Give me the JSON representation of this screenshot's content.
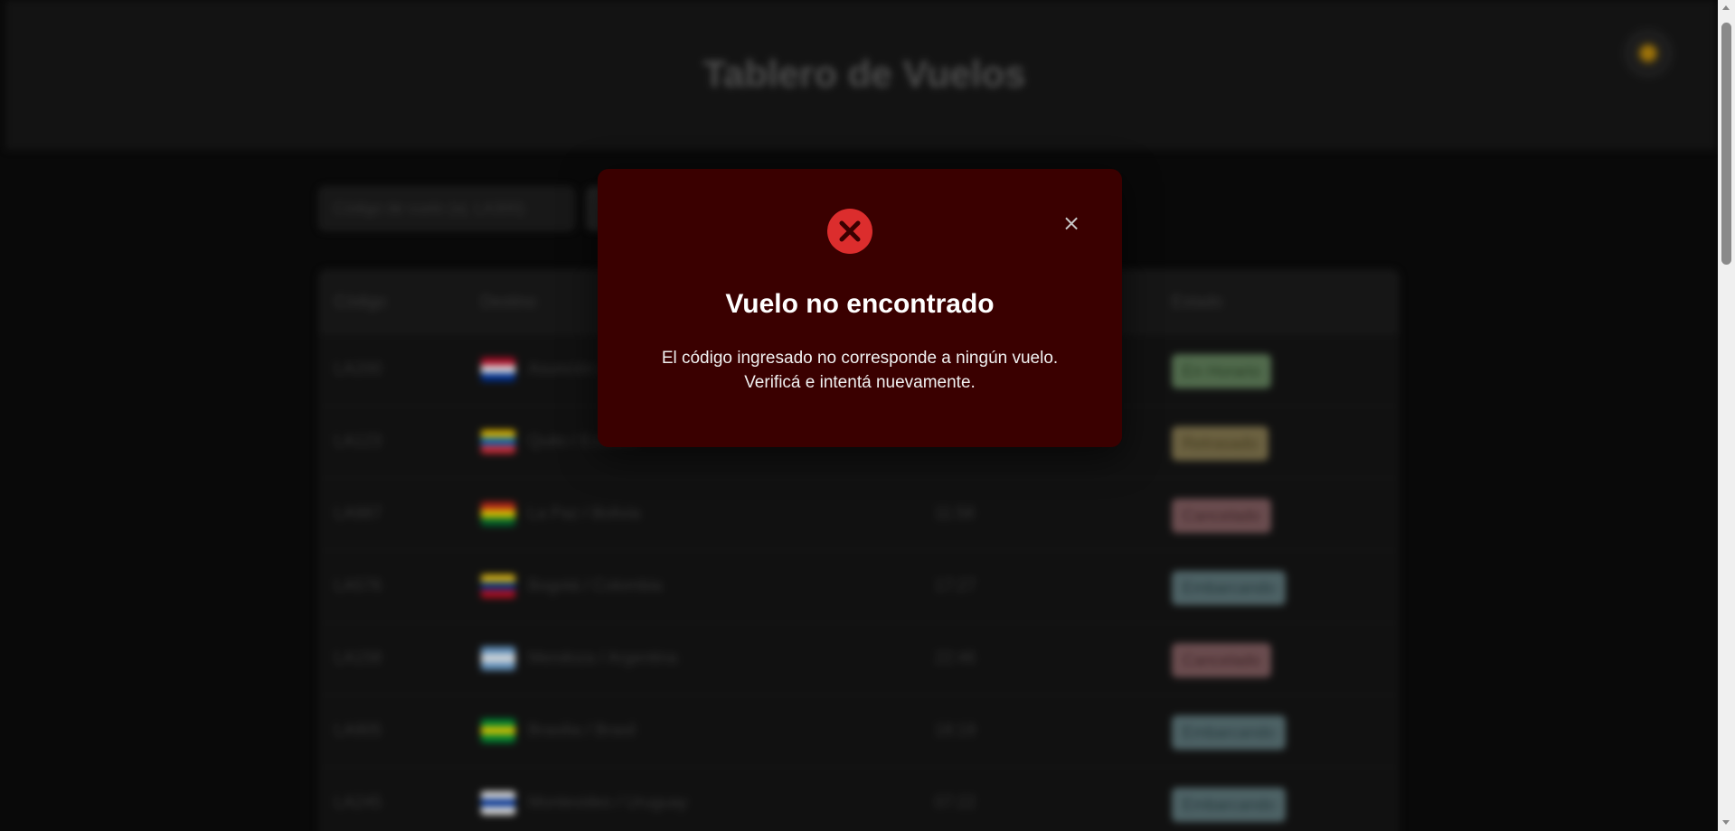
{
  "page": {
    "title": "Tablero de Vuelos",
    "theme_icon": "sun-icon"
  },
  "search": {
    "placeholder": "Código de vuelo (ej. LA300)"
  },
  "table": {
    "headers": [
      "Código",
      "Destino",
      "",
      "Estado"
    ],
    "rows": [
      {
        "code": "LA200",
        "destination": "Asunción / Paraguay",
        "time": "",
        "status": "En Horario",
        "flag": [
          "#c8102e",
          "#ffffff",
          "#0038a8"
        ],
        "badge_bg": "#5f7d5a",
        "badge_fg": "#2f4a2b"
      },
      {
        "code": "LA123",
        "destination": "Quito / Ecuador",
        "time": "",
        "status": "Retrasado",
        "flag": [
          "#ffd100",
          "#0072ce",
          "#ef3340"
        ],
        "badge_bg": "#7f734d",
        "badge_fg": "#4d4322"
      },
      {
        "code": "LA987",
        "destination": "La Paz / Bolivia",
        "time": "11:58",
        "status": "Cancelado",
        "flag": [
          "#d52b1e",
          "#f9e300",
          "#007934"
        ],
        "badge_bg": "#7d5a5d",
        "badge_fg": "#4a2a2d"
      },
      {
        "code": "LA576",
        "destination": "Bogotá / Colombia",
        "time": "17:27",
        "status": "Embarcando",
        "flag": [
          "#fcd116",
          "#003893",
          "#ce1126"
        ],
        "badge_bg": "#5b7377",
        "badge_fg": "#2c4246"
      },
      {
        "code": "LA158",
        "destination": "Mendoza / Argentina",
        "time": "22:46",
        "status": "Cancelado",
        "flag": [
          "#74acdf",
          "#ffffff",
          "#74acdf"
        ],
        "badge_bg": "#7d5a5d",
        "badge_fg": "#4a2a2d"
      },
      {
        "code": "LA905",
        "destination": "Brasilia / Brasil",
        "time": "18:19",
        "status": "Embarcando",
        "flag": [
          "#009c3b",
          "#ffdf00",
          "#009c3b"
        ],
        "badge_bg": "#5b7377",
        "badge_fg": "#2c4246"
      },
      {
        "code": "LA245",
        "destination": "Montevideo / Uruguay",
        "time": "07:22",
        "status": "Embarcando",
        "flag": [
          "#ffffff",
          "#0038a8",
          "#ffffff"
        ],
        "badge_bg": "#5b7377",
        "badge_fg": "#2c4246"
      }
    ]
  },
  "modal": {
    "icon": "error-x-icon",
    "title": "Vuelo no encontrado",
    "message_line1": "El código ingresado no corresponde a ningún vuelo.",
    "message_line2": "Verificá e intentá nuevamente.",
    "close_label": "×"
  }
}
